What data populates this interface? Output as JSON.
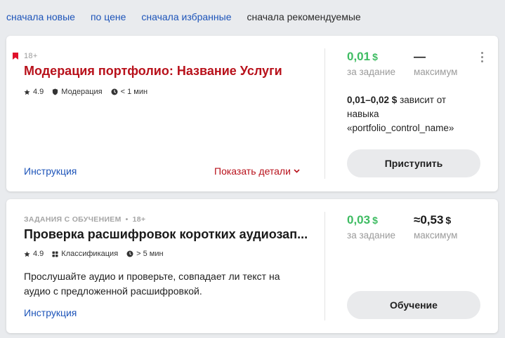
{
  "sort": {
    "options": [
      "сначала новые",
      "по цене",
      "сначала избранные",
      "сначала рекомендуемые"
    ],
    "active_index": 3
  },
  "tasks": [
    {
      "bookmarked": true,
      "tag": "",
      "age": "18+",
      "title": "Модерация портфолио: Название Услуги",
      "rating": "4.9",
      "category": "Модерация",
      "duration": "< 1 мин",
      "description": "",
      "instruction_link": "Инструкция",
      "details_link": "Показать детали",
      "price": "0,01",
      "price_currency": "$",
      "price_label": "за задание",
      "max": "—",
      "max_currency": "",
      "max_label": "максимум",
      "note_bold": "0,01–0,02 $",
      "note_text": " зависит от навыка «portfolio_control_name»",
      "button": "Приступить"
    },
    {
      "bookmarked": false,
      "tag": "ЗАДАНИЯ С ОБУЧЕНИЕМ",
      "age": "18+",
      "title": "Проверка расшифровок коротких аудиозап...",
      "rating": "4.9",
      "category": "Классификация",
      "duration": "> 5 мин",
      "description": "Прослушайте аудио и проверьте, совпадает ли текст на аудио с предложенной расшифровкой.",
      "instruction_link": "Инструкция",
      "details_link": "",
      "price": "0,03",
      "price_currency": "$",
      "price_label": "за задание",
      "max": "≈0,53",
      "max_currency": "$",
      "max_label": "максимум",
      "note_bold": "",
      "note_text": "",
      "button": "Обучение"
    }
  ],
  "colors": {
    "price_green": "#3ebc62",
    "title_red": "#b8111b",
    "link_blue": "#1d54b9",
    "bookmark_red": "#e0102b"
  },
  "icons": [
    "bookmark-icon",
    "star-icon",
    "shield-icon",
    "clock-icon",
    "grid-icon",
    "chevron-down-icon",
    "kebab-menu-icon"
  ]
}
